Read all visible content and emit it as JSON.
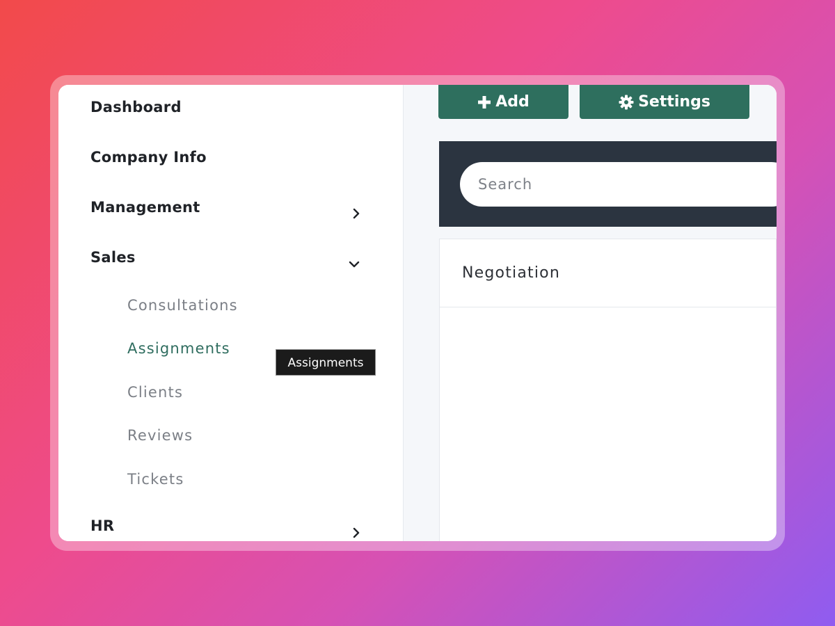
{
  "sidebar": {
    "items": [
      {
        "label": "Dashboard"
      },
      {
        "label": "Company Info"
      },
      {
        "label": "Management",
        "chevron": "chevron-right-icon"
      },
      {
        "label": "Sales",
        "chevron": "chevron-down-icon"
      },
      {
        "label": "HR",
        "chevron": "chevron-right-icon"
      }
    ],
    "sales_subitems": [
      {
        "label": "Consultations"
      },
      {
        "label": "Assignments",
        "active": true
      },
      {
        "label": "Clients"
      },
      {
        "label": "Reviews"
      },
      {
        "label": "Tickets"
      }
    ]
  },
  "tooltip": {
    "text": "Assignments"
  },
  "toolbar": {
    "add_label": "Add",
    "add_icon": "plus-icon",
    "settings_label": "Settings",
    "settings_icon": "gear-icon"
  },
  "search": {
    "placeholder": "Search",
    "value": ""
  },
  "panel": {
    "title": "Negotiation"
  },
  "colors": {
    "accent": "#2e6f5e",
    "active_link": "#2f6d5f",
    "search_bar": "#2b3440",
    "tooltip_bg": "#1b1b1b"
  }
}
